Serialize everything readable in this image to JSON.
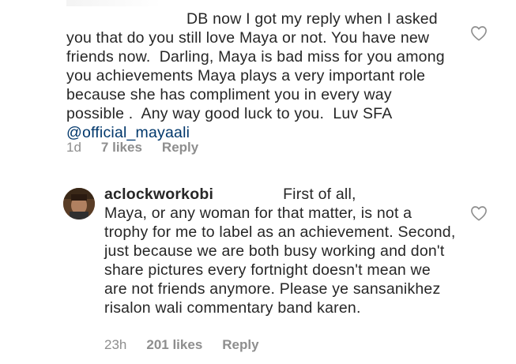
{
  "comments": [
    {
      "text_line1": "DB now I got my reply when I asked",
      "text_rest": "you that do you still love Maya or not. You have new friends now.  Darling, Maya is bad miss for you among you achievements Maya plays a very important role because she has compliment you in every way possible .  Any way good luck to you.  Luv SFA",
      "mention": "@official_mayaali",
      "time": "1d",
      "likes": "7 likes",
      "reply": "Reply"
    },
    {
      "username": "aclockworkobi",
      "text_line1": "First of all,",
      "text_rest": "Maya, or any woman for that matter, is not a trophy for me to label as an achievement. Second, just because we are both busy working and don't share pictures every fortnight doesn't mean we are not friends anymore. Please ye sansanikhez risalon wali commentary band karen.",
      "time": "23h",
      "likes": "201 likes",
      "reply": "Reply"
    }
  ],
  "icons": {
    "like": "heart-outline-icon",
    "avatar": "user-avatar"
  },
  "colors": {
    "text": "#262626",
    "meta": "#8e8e8e",
    "mention": "#00376b"
  }
}
